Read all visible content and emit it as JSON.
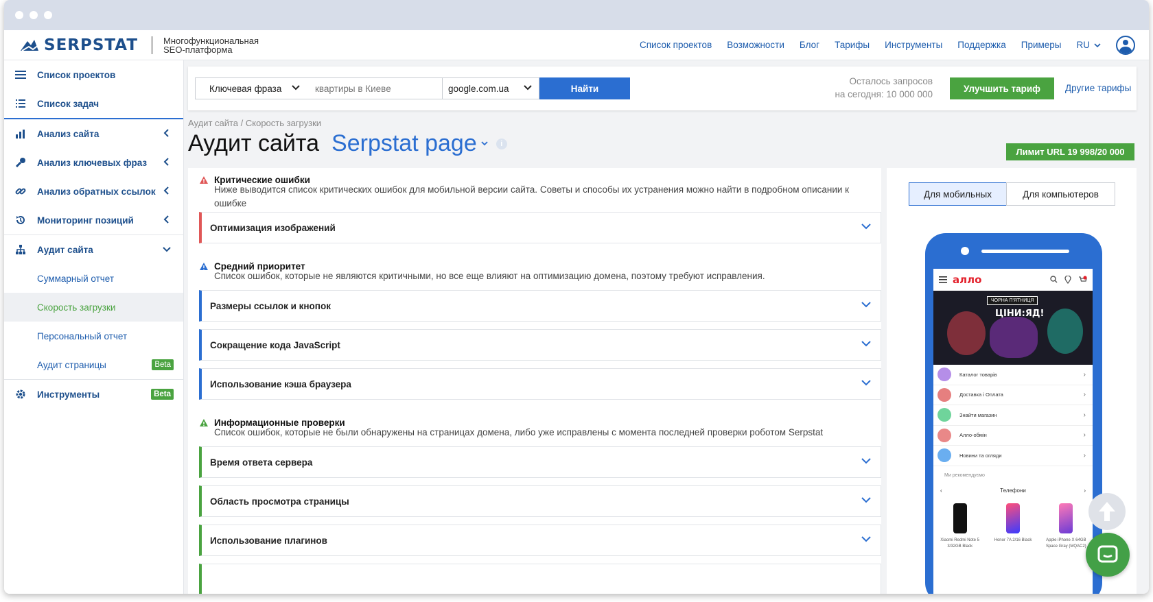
{
  "header": {
    "logo_text": "SERPSTAT",
    "tagline_line1": "Многофункциональная",
    "tagline_line2": "SEO-платформа",
    "nav": [
      "Список проектов",
      "Возможности",
      "Блог",
      "Тарифы",
      "Инструменты",
      "Поддержка",
      "Примеры"
    ],
    "lang": "RU"
  },
  "sidebar": {
    "top_items": [
      {
        "label": "Список проектов",
        "icon": "menu-icon"
      },
      {
        "label": "Список задач",
        "icon": "list-icon"
      }
    ],
    "items": [
      {
        "label": "Анализ сайта",
        "icon": "chart-icon"
      },
      {
        "label": "Анализ ключевых фраз",
        "icon": "key-icon"
      },
      {
        "label": "Анализ обратных ссылок",
        "icon": "link-icon"
      },
      {
        "label": "Мониторинг позиций",
        "icon": "history-icon"
      },
      {
        "label": "Аудит сайта",
        "icon": "sitemap-icon"
      }
    ],
    "sub_items": [
      "Суммарный отчет",
      "Скорость загрузки",
      "Персональный отчет",
      "Аудит страницы"
    ],
    "beta_label": "Beta",
    "tools_label": "Инструменты"
  },
  "search": {
    "type_label": "Ключевая фраза",
    "query_placeholder": "квартиры в Киеве",
    "engine": "google.com.ua",
    "find_label": "Найти",
    "quota_line1": "Осталось запросов",
    "quota_line2": "на сегодня: 10 000 000",
    "upgrade_label": "Улучшить тариф",
    "other_plans_label": "Другие тарифы"
  },
  "page": {
    "breadcrumb": "Аудит сайта / Скорость загрузки",
    "title": "Аудит сайта",
    "project": "Serpstat page",
    "limit": "Лимит URL 19 998/20 000"
  },
  "sections": {
    "critical": {
      "title": "Критические ошибки",
      "desc": "Ниже выводится список критических ошибок для мобильной версии сайта. Советы и способы их устранения можно найти в подробном описании к ошибке",
      "items": [
        "Оптимизация изображений"
      ]
    },
    "medium": {
      "title": "Средний приоритет",
      "desc": "Список ошибок, которые не являются критичными, но все еще влияют на оптимизацию домена, поэтому требуют исправления.",
      "items": [
        "Размеры ссылок и кнопок",
        "Сокращение кода JavaScript",
        "Использование кэша браузера"
      ]
    },
    "info": {
      "title": "Информационные проверки",
      "desc": "Список ошибок, которые не были обнаружены на страницах домена, либо уже исправлены с момента последней проверки роботом Serpstat",
      "items": [
        "Время ответа сервера",
        "Область просмотра страницы",
        "Использование плагинов"
      ]
    }
  },
  "device": {
    "mobile_label": "Для мобильных",
    "desktop_label": "Для компьютеров"
  },
  "phone_screen": {
    "logo": "алло",
    "banner_tag": "ЧОРНА П'ЯТНИЦЯ",
    "banner_title": "ЦІНИ:ЯД!",
    "rows": [
      "Каталог товарів",
      "Доставка і Оплата",
      "Знайти магазин",
      "Алло-обмін",
      "Новини та огляди"
    ],
    "recommend": "Ми рекомендуємо",
    "tab": "Телефони",
    "products": [
      {
        "name": "Xiaomi Redmi Note 5 3/32GB Black"
      },
      {
        "name": "Honor 7A 2/16 Black"
      },
      {
        "name": "Apple iPhone X 64GB Space Gray (MQAC2)"
      }
    ]
  },
  "colors": {
    "brand_blue": "#2b6ed1",
    "accent_green": "#4aa340",
    "critical_red": "#e05757"
  }
}
